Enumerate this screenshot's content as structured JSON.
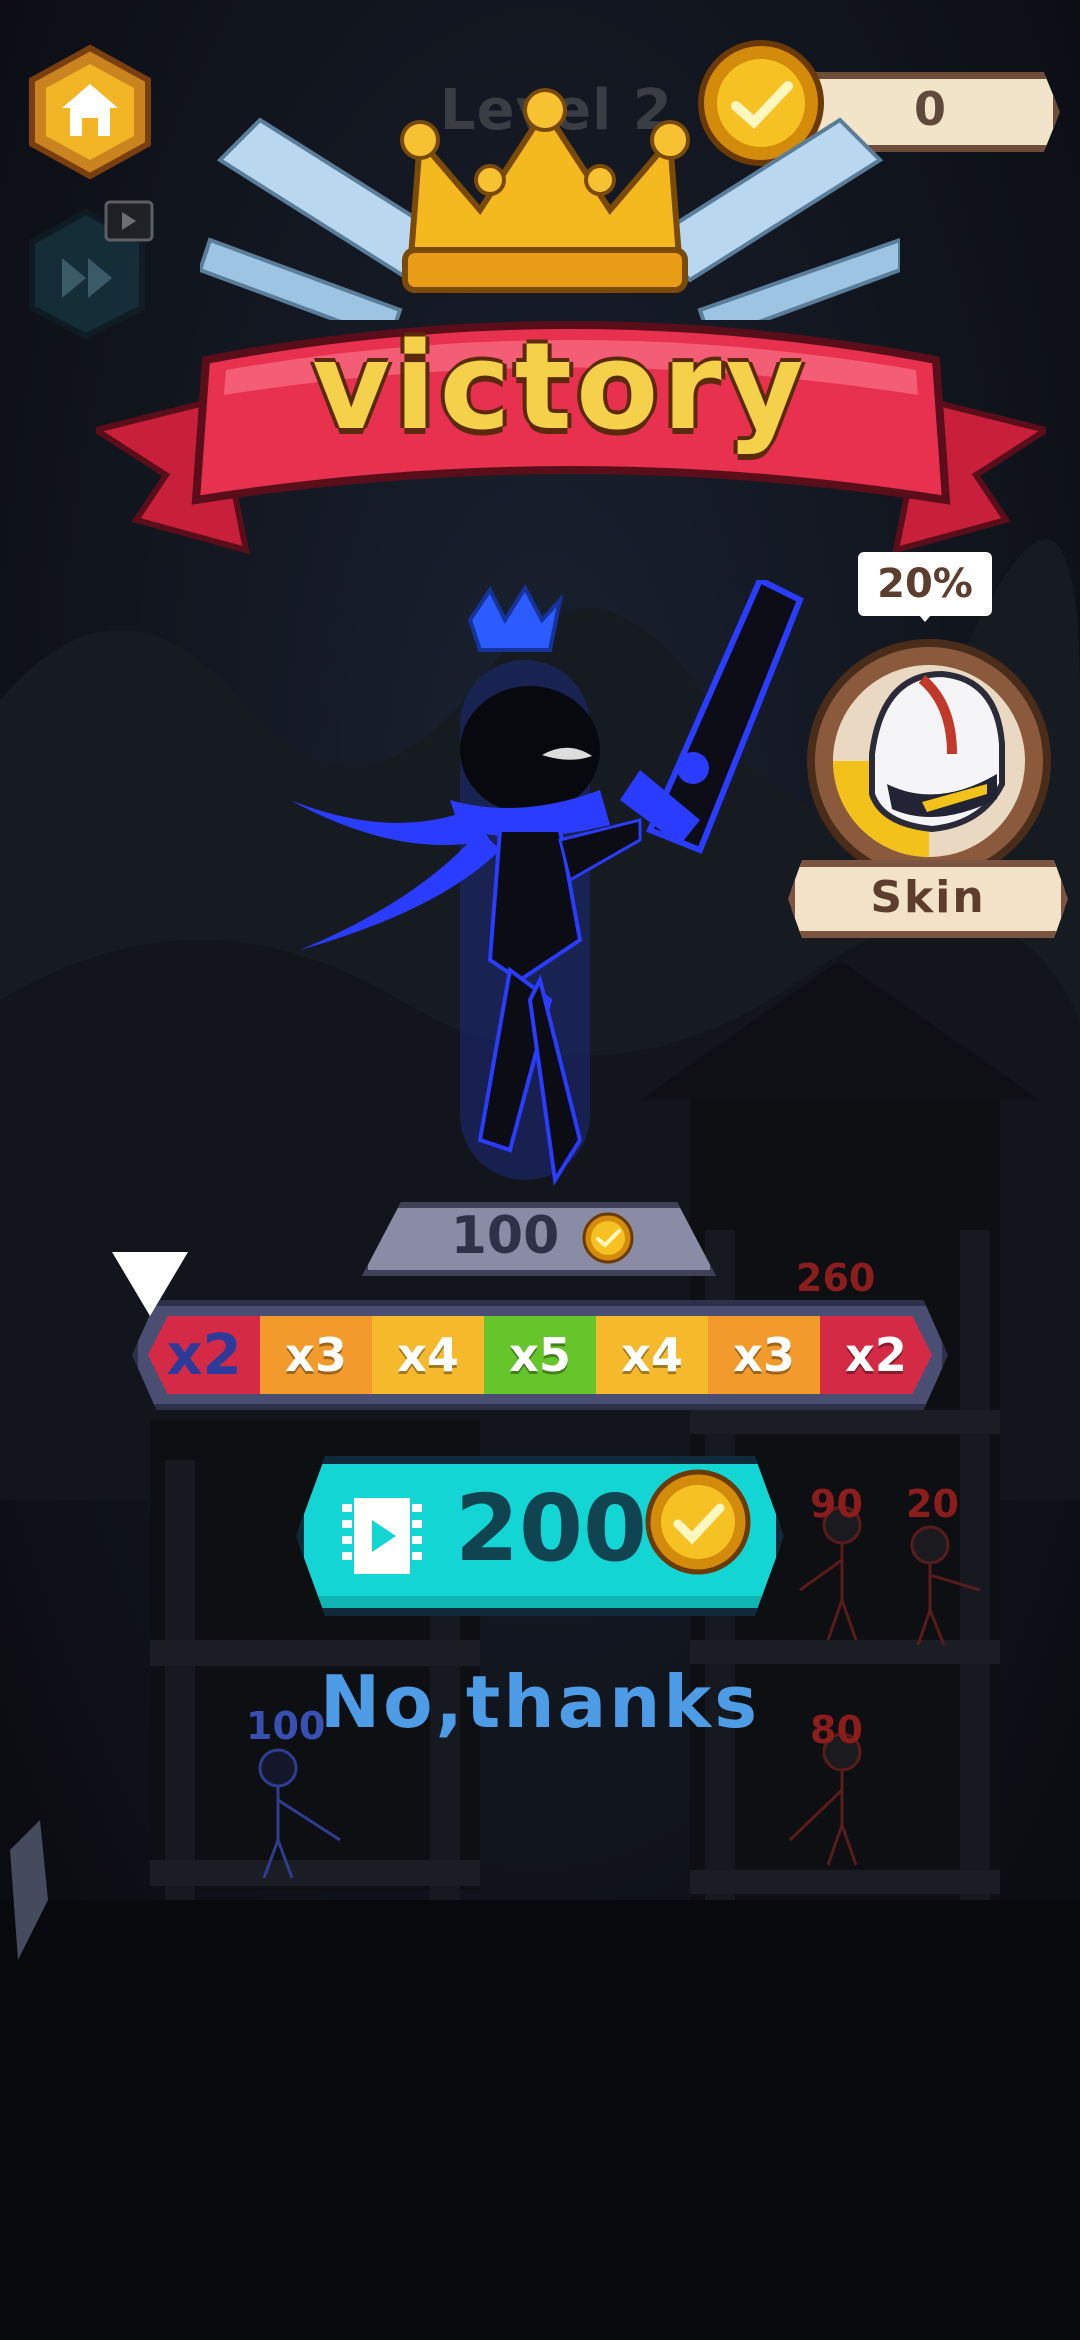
{
  "level": {
    "title": "Level 2"
  },
  "coins": {
    "balance": "0"
  },
  "banner": {
    "title": "victory"
  },
  "skin": {
    "progress_label": "20%",
    "progress": 0.2,
    "button_label": "Skin"
  },
  "reward": {
    "base_value": "100",
    "claim_value": "200",
    "no_thanks_label": "No,thanks"
  },
  "multiplier": {
    "segments": [
      {
        "label": "x2",
        "color": "#d42a46"
      },
      {
        "label": "x3",
        "color": "#f29a2b"
      },
      {
        "label": "x4",
        "color": "#f7b92c"
      },
      {
        "label": "x5",
        "color": "#67c52c"
      },
      {
        "label": "x4",
        "color": "#f7b92c"
      },
      {
        "label": "x3",
        "color": "#f29a2b"
      },
      {
        "label": "x2",
        "color": "#d42a46"
      }
    ],
    "selected_label": "x2"
  },
  "enemies": {
    "hp_top": "260",
    "hp_mid_left": "90",
    "hp_mid_right": "20",
    "hp_bottom": "80"
  },
  "player": {
    "hp": "100"
  },
  "icons": {
    "home": "home-icon",
    "skip": "skip-icon",
    "video": "video-icon",
    "coin": "coin-icon",
    "crown": "crown-icon",
    "helmet": "helmet-icon"
  }
}
